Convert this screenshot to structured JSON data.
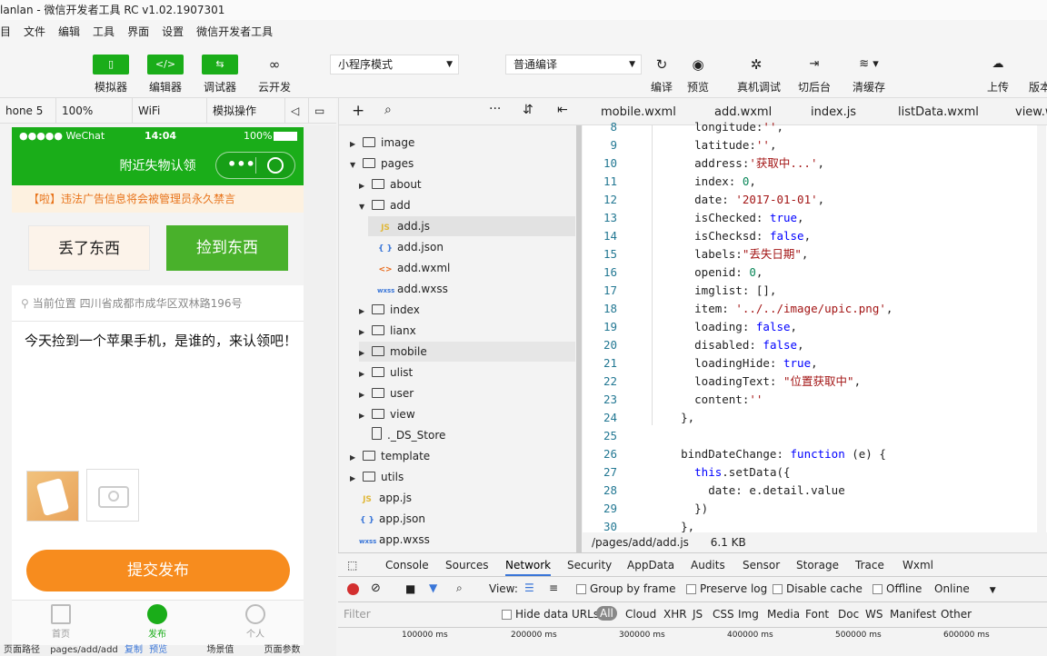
{
  "window": {
    "title": "lanlan - 微信开发者工具 RC v1.02.1907301"
  },
  "menu": [
    "目",
    "文件",
    "编辑",
    "工具",
    "界面",
    "设置",
    "微信开发者工具"
  ],
  "toolbar": {
    "simulator": "模拟器",
    "editor": "编辑器",
    "debugger": "调试器",
    "cloud": "云开发",
    "mode": "小程序模式",
    "compile": "普通编译",
    "compile_btn": "编译",
    "preview": "预览",
    "real_debug": "真机调试",
    "background": "切后台",
    "clear_cache": "清缓存",
    "upload": "上传",
    "version": "版本"
  },
  "device_bar": {
    "device": "hone 5",
    "zoom": "100%",
    "network": "WiFi",
    "sim_ops": "模拟操作"
  },
  "phone": {
    "status_carrier": "●●●●● WeChat",
    "status_time": "14:04",
    "status_battery": "100%",
    "nav_title": "附近失物认领",
    "notice": "【啦】违法广告信息将会被管理员永久禁言",
    "tab_lost": "丢了东西",
    "tab_found": "捡到东西",
    "location": "当前位置  四川省成都市成华区双林路196号",
    "content": "今天捡到一个苹果手机，是谁的，来认领吧！",
    "submit": "提交发布",
    "tabbar": [
      "首页",
      "发布",
      "个人"
    ]
  },
  "tree": {
    "items": [
      {
        "label": "image",
        "type": "folder",
        "level": 0,
        "open": false
      },
      {
        "label": "pages",
        "type": "folder",
        "level": 0,
        "open": true
      },
      {
        "label": "about",
        "type": "folder",
        "level": 1,
        "open": false
      },
      {
        "label": "add",
        "type": "folder",
        "level": 1,
        "open": true
      },
      {
        "label": "add.js",
        "type": "js",
        "level": 2
      },
      {
        "label": "add.json",
        "type": "json",
        "level": 2
      },
      {
        "label": "add.wxml",
        "type": "wxml",
        "level": 2
      },
      {
        "label": "add.wxss",
        "type": "wxss",
        "level": 2
      },
      {
        "label": "index",
        "type": "folder",
        "level": 1,
        "open": false
      },
      {
        "label": "lianx",
        "type": "folder",
        "level": 1,
        "open": false
      },
      {
        "label": "mobile",
        "type": "folder",
        "level": 1,
        "open": false
      },
      {
        "label": "ulist",
        "type": "folder",
        "level": 1,
        "open": false
      },
      {
        "label": "user",
        "type": "folder",
        "level": 1,
        "open": false
      },
      {
        "label": "view",
        "type": "folder",
        "level": 1,
        "open": false
      },
      {
        "label": "._DS_Store",
        "type": "file",
        "level": 1
      },
      {
        "label": "template",
        "type": "folder",
        "level": 0,
        "open": false
      },
      {
        "label": "utils",
        "type": "folder",
        "level": 0,
        "open": false
      },
      {
        "label": "app.js",
        "type": "js",
        "level": 0
      },
      {
        "label": "app.json",
        "type": "json",
        "level": 0
      },
      {
        "label": "app.wxss",
        "type": "wxss",
        "level": 0
      }
    ]
  },
  "editor": {
    "tabs": [
      "mobile.wxml",
      "add.wxml",
      "index.js",
      "listData.wxml",
      "view.w"
    ],
    "status_path": "/pages/add/add.js",
    "status_size": "6.1 KB",
    "lines": [
      {
        "n": "8",
        "t": "      longitude:'',"
      },
      {
        "n": "9",
        "t": "      latitude:'',"
      },
      {
        "n": "10",
        "t": "      address:'获取中...',"
      },
      {
        "n": "11",
        "t": "      index: 0,"
      },
      {
        "n": "12",
        "t": "      date: '2017-01-01',"
      },
      {
        "n": "13",
        "t": "      isChecked: true,"
      },
      {
        "n": "14",
        "t": "      isChecksd: false,"
      },
      {
        "n": "15",
        "t": "      labels:\"丢失日期\","
      },
      {
        "n": "16",
        "t": "      openid: 0,"
      },
      {
        "n": "17",
        "t": "      imglist: [],"
      },
      {
        "n": "18",
        "t": "      item: '../../image/upic.png',"
      },
      {
        "n": "19",
        "t": "      loading: false,"
      },
      {
        "n": "20",
        "t": "      disabled: false,"
      },
      {
        "n": "21",
        "t": "      loadingHide: true,"
      },
      {
        "n": "22",
        "t": "      loadingText: \"位置获取中\","
      },
      {
        "n": "23",
        "t": "      content:''"
      },
      {
        "n": "24",
        "t": "    },"
      },
      {
        "n": "25",
        "t": ""
      },
      {
        "n": "26",
        "t": "    bindDateChange: function (e) {"
      },
      {
        "n": "27",
        "t": "      this.setData({"
      },
      {
        "n": "28",
        "t": "        date: e.detail.value"
      },
      {
        "n": "29",
        "t": "      })"
      },
      {
        "n": "30",
        "t": "    },"
      }
    ]
  },
  "devtools": {
    "tabs": [
      "Console",
      "Sources",
      "Network",
      "Security",
      "AppData",
      "Audits",
      "Sensor",
      "Storage",
      "Trace",
      "Wxml"
    ],
    "active_tab": "Network",
    "view_label": "View:",
    "group_by_frame": "Group by frame",
    "preserve_log": "Preserve log",
    "disable_cache": "Disable cache",
    "offline": "Offline",
    "online": "Online",
    "filter": "Filter",
    "hide_data_urls": "Hide data URLs",
    "types": [
      "All",
      "Cloud",
      "XHR",
      "JS",
      "CSS",
      "Img",
      "Media",
      "Font",
      "Doc",
      "WS",
      "Manifest",
      "Other"
    ],
    "timeline": [
      "100000 ms",
      "200000 ms",
      "300000 ms",
      "400000 ms",
      "500000 ms",
      "600000 ms"
    ]
  },
  "bottom": {
    "path_label": "页面路径",
    "path": "pages/add/add",
    "copy": "复制",
    "preview": "预览",
    "scene": "场景值",
    "params": "页面参数"
  },
  "colors": {
    "accent": "#1aad19",
    "orange": "#f78c1e",
    "notice": "#e8741b"
  }
}
